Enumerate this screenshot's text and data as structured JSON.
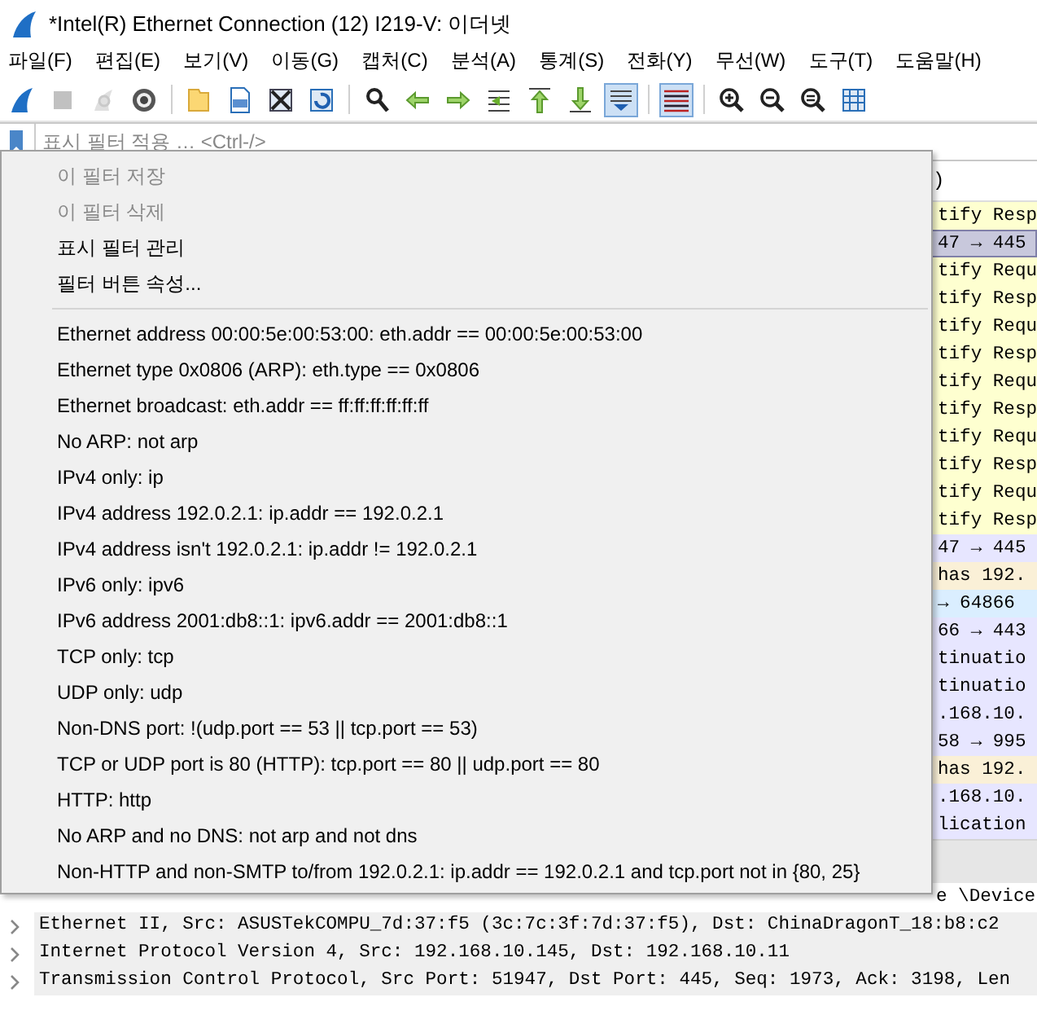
{
  "window": {
    "title": "*Intel(R) Ethernet Connection (12) I219-V: 이더넷"
  },
  "menu": [
    "파일(F)",
    "편집(E)",
    "보기(V)",
    "이동(G)",
    "캡처(C)",
    "분석(A)",
    "통계(S)",
    "전화(Y)",
    "무선(W)",
    "도구(T)",
    "도움말(H)"
  ],
  "toolbar": [
    {
      "kind": "fin",
      "disabled": false,
      "pressed": false
    },
    {
      "kind": "stop",
      "disabled": true,
      "pressed": false
    },
    {
      "kind": "restart",
      "disabled": true,
      "pressed": false
    },
    {
      "kind": "gear",
      "disabled": false,
      "pressed": false
    },
    {
      "kind": "separator"
    },
    {
      "kind": "folder",
      "disabled": false,
      "pressed": false
    },
    {
      "kind": "file",
      "disabled": false,
      "pressed": false
    },
    {
      "kind": "close",
      "disabled": false,
      "pressed": false
    },
    {
      "kind": "reload",
      "disabled": false,
      "pressed": false
    },
    {
      "kind": "separator"
    },
    {
      "kind": "search",
      "disabled": false,
      "pressed": false
    },
    {
      "kind": "back",
      "disabled": false,
      "pressed": false
    },
    {
      "kind": "forward",
      "disabled": false,
      "pressed": false
    },
    {
      "kind": "jump",
      "disabled": false,
      "pressed": false
    },
    {
      "kind": "first",
      "disabled": false,
      "pressed": false
    },
    {
      "kind": "last",
      "disabled": false,
      "pressed": false
    },
    {
      "kind": "autoscroll",
      "disabled": false,
      "pressed": true
    },
    {
      "kind": "separator"
    },
    {
      "kind": "colorize",
      "disabled": false,
      "pressed": true
    },
    {
      "kind": "separator"
    },
    {
      "kind": "zoomin",
      "disabled": false,
      "pressed": false
    },
    {
      "kind": "zoomout",
      "disabled": false,
      "pressed": false
    },
    {
      "kind": "zoomreset",
      "disabled": false,
      "pressed": false
    },
    {
      "kind": "columns",
      "disabled": false,
      "pressed": false
    }
  ],
  "filter_bar": {
    "placeholder": "표시 필터 적용 … <Ctrl-/>"
  },
  "filter_menu": {
    "top_items": [
      {
        "label": "이 필터 저장",
        "disabled": true
      },
      {
        "label": "이 필터 삭제",
        "disabled": true
      },
      {
        "label": "표시 필터 관리",
        "disabled": false
      },
      {
        "label": "필터 버튼 속성...",
        "disabled": false
      }
    ],
    "filters": [
      "Ethernet address 00:00:5e:00:53:00: eth.addr == 00:00:5e:00:53:00",
      "Ethernet type 0x0806 (ARP): eth.type == 0x0806",
      "Ethernet broadcast: eth.addr == ff:ff:ff:ff:ff:ff",
      "No ARP: not arp",
      "IPv4 only: ip",
      "IPv4 address 192.0.2.1: ip.addr == 192.0.2.1",
      "IPv4 address isn't 192.0.2.1: ip.addr != 192.0.2.1",
      "IPv6 only: ipv6",
      "IPv6 address 2001:db8::1: ipv6.addr == 2001:db8::1",
      "TCP only: tcp",
      "UDP only: udp",
      "Non-DNS port: !(udp.port == 53 || tcp.port == 53)",
      "TCP or UDP port is 80 (HTTP): tcp.port == 80 || udp.port == 80",
      "HTTP: http",
      "No ARP and no DNS: not arp and not dns",
      "Non-HTTP and non-SMTP to/from 192.0.2.1: ip.addr == 192.0.2.1 and tcp.port not in {80, 25}"
    ]
  },
  "packet_list": {
    "header_fragment": ")",
    "rows": [
      {
        "text": "tify Resp",
        "color": "#feffd0",
        "selected": false
      },
      {
        "text": "47 → 445",
        "color": "#c8c8dc",
        "selected": true
      },
      {
        "text": "tify Requ",
        "color": "#feffd0",
        "selected": false
      },
      {
        "text": "tify Resp",
        "color": "#feffd0",
        "selected": false
      },
      {
        "text": "tify Requ",
        "color": "#feffd0",
        "selected": false
      },
      {
        "text": "tify Resp",
        "color": "#feffd0",
        "selected": false
      },
      {
        "text": "tify Requ",
        "color": "#feffd0",
        "selected": false
      },
      {
        "text": "tify Resp",
        "color": "#feffd0",
        "selected": false
      },
      {
        "text": "tify Requ",
        "color": "#feffd0",
        "selected": false
      },
      {
        "text": "tify Resp",
        "color": "#feffd0",
        "selected": false
      },
      {
        "text": "tify Requ",
        "color": "#feffd0",
        "selected": false
      },
      {
        "text": "tify Resp",
        "color": "#feffd0",
        "selected": false
      },
      {
        "text": "47 → 445",
        "color": "#e7e6ff",
        "selected": false
      },
      {
        "text": "has 192.",
        "color": "#faf0d7",
        "selected": false
      },
      {
        "text": "→ 64866",
        "color": "#daeeff",
        "selected": false
      },
      {
        "text": "66 → 443",
        "color": "#e7e6ff",
        "selected": false
      },
      {
        "text": "tinuatio",
        "color": "#e7e6ff",
        "selected": false
      },
      {
        "text": "tinuatio",
        "color": "#e7e6ff",
        "selected": false
      },
      {
        "text": ".168.10.",
        "color": "#e7e6ff",
        "selected": false
      },
      {
        "text": "58 → 995",
        "color": "#e7e6ff",
        "selected": false
      },
      {
        "text": "has 192.",
        "color": "#faf0d7",
        "selected": false
      },
      {
        "text": ".168.10.",
        "color": "#e7e6ff",
        "selected": false
      },
      {
        "text": "lication",
        "color": "#e7e6ff",
        "selected": false
      }
    ]
  },
  "details": [
    {
      "kind": "covered",
      "text": "e \\Device"
    },
    {
      "kind": "row",
      "text": "Ethernet II, Src: ASUSTekCOMPU_7d:37:f5 (3c:7c:3f:7d:37:f5), Dst: ChinaDragonT_18:b8:c2",
      "expanded": false
    },
    {
      "kind": "row",
      "text": "Internet Protocol Version 4, Src: 192.168.10.145, Dst: 192.168.10.11",
      "expanded": false
    },
    {
      "kind": "row",
      "text": "Transmission Control Protocol, Src Port: 51947, Dst Port: 445, Seq: 1973, Ack: 3198, Len",
      "expanded": false
    }
  ]
}
